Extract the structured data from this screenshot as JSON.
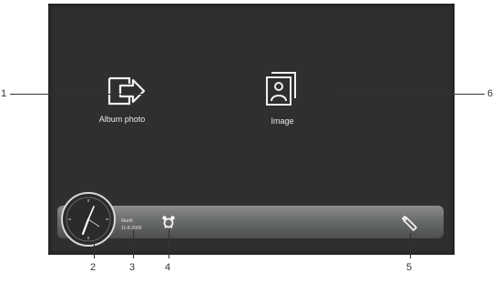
{
  "menu": {
    "album_label": "Album photo",
    "image_label": "Image"
  },
  "statusbar": {
    "day": "Mardi",
    "date": "11-8-2009",
    "icons": [
      "analog-clock-icon",
      "alarm-icon",
      "settings-wrench-icon"
    ]
  },
  "callouts": [
    "1",
    "2",
    "3",
    "4",
    "5",
    "6"
  ]
}
